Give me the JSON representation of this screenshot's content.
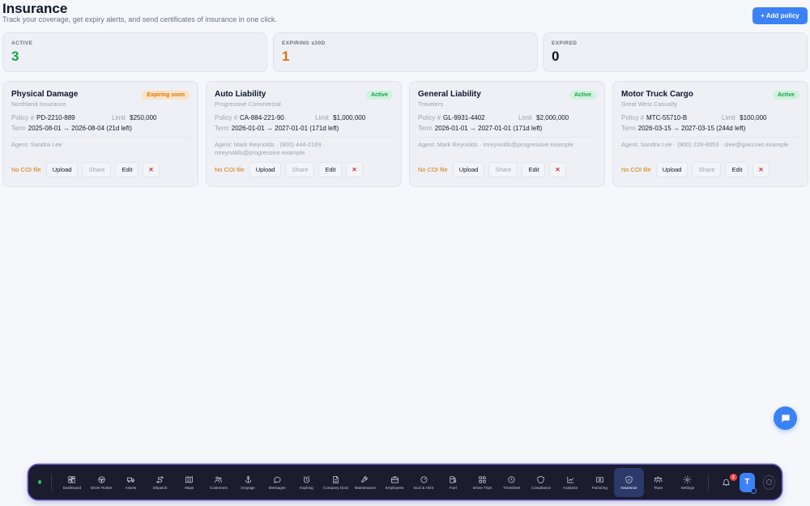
{
  "page": {
    "title": "Insurance",
    "subtitle": "Track your coverage, get expiry alerts, and send certificates of insurance in one click.",
    "add_button": "+ Add policy"
  },
  "stats": [
    {
      "label": "ACTIVE",
      "value": "3",
      "color": "#16a34a"
    },
    {
      "label": "EXPIRING ≤30D",
      "value": "1",
      "color": "#d97706"
    },
    {
      "label": "EXPIRED",
      "value": "0",
      "color": "#111827"
    }
  ],
  "labels": {
    "policy": "Policy #",
    "limit": "Limit",
    "term": "Term",
    "no_coi": "No COI file",
    "upload": "Upload",
    "share": "Share",
    "edit": "Edit",
    "delete": "✕"
  },
  "policies": [
    {
      "title": "Physical Damage",
      "insurer": "Northland Insurance",
      "status": "Expiring soon",
      "status_type": "exp",
      "policy_no": "PD-2210-889",
      "limit": "$250,000",
      "term": "2025-08-01 → 2026-08-04 (21d left)",
      "agent": "Agent: Sandra Lee"
    },
    {
      "title": "Auto Liability",
      "insurer": "Progressive Commercial",
      "status": "Active",
      "status_type": "active",
      "policy_no": "CA-884-221-90",
      "limit": "$1,000,000",
      "term": "2026-01-01 → 2027-01-01 (171d left)",
      "agent": "Agent: Mark Reynolds · (800) 444-2189 · mreynolds@progressive.example"
    },
    {
      "title": "General Liability",
      "insurer": "Travelers",
      "status": "Active",
      "status_type": "active",
      "policy_no": "GL-9931-4402",
      "limit": "$2,000,000",
      "term": "2026-01-01 → 2027-01-01 (171d left)",
      "agent": "Agent: Mark Reynolds · mreynolds@progressive.example"
    },
    {
      "title": "Motor Truck Cargo",
      "insurer": "Great West Casualty",
      "status": "Active",
      "status_type": "active",
      "policy_no": "MTC-55710-B",
      "limit": "$100,000",
      "term": "2026-03-15 → 2027-03-15 (244d left)",
      "agent": "Agent: Sandra Lee · (800) 228-8053 · slee@gwccnet.example"
    }
  ],
  "dock": {
    "items": [
      {
        "label": "Dashboard",
        "icon": "dashboard-icon"
      },
      {
        "label": "Driver Roster",
        "icon": "steering-wheel-icon"
      },
      {
        "label": "Assets",
        "icon": "truck-icon"
      },
      {
        "label": "Dispatch",
        "icon": "route-icon"
      },
      {
        "label": "Maps",
        "icon": "map-icon"
      },
      {
        "label": "Customers",
        "icon": "users-icon"
      },
      {
        "label": "Drayage",
        "icon": "anchor-icon"
      },
      {
        "label": "Messages",
        "icon": "message-icon"
      },
      {
        "label": "Expiring",
        "icon": "alarm-clock-icon"
      },
      {
        "label": "Company Docs",
        "icon": "document-icon"
      },
      {
        "label": "Maintenance",
        "icon": "wrench-icon"
      },
      {
        "label": "Employees",
        "icon": "briefcase-icon"
      },
      {
        "label": "ELD & HOS",
        "icon": "gauge-icon"
      },
      {
        "label": "Fuel",
        "icon": "fuel-icon"
      },
      {
        "label": "Driver Trips",
        "icon": "grid-icon"
      },
      {
        "label": "Timesheet",
        "icon": "clock-icon"
      },
      {
        "label": "Compliance",
        "icon": "shield-icon"
      },
      {
        "label": "Analytics",
        "icon": "chart-icon"
      },
      {
        "label": "Factoring",
        "icon": "cash-icon"
      },
      {
        "label": "Insurance",
        "icon": "shield-check-icon",
        "active": true
      },
      {
        "label": "Team",
        "icon": "team-icon"
      },
      {
        "label": "Settings",
        "icon": "gear-icon"
      }
    ],
    "notification_count": "2",
    "avatar_initial": "T"
  }
}
